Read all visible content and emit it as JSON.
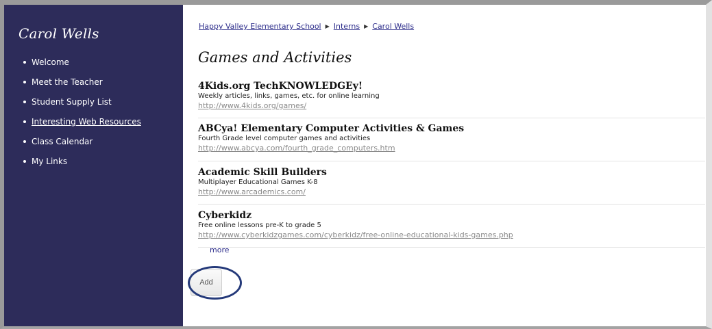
{
  "sidebar": {
    "title": "Carol Wells",
    "items": [
      {
        "label": "Welcome"
      },
      {
        "label": "Meet the Teacher"
      },
      {
        "label": "Student Supply List"
      },
      {
        "label": "Interesting Web Resources"
      },
      {
        "label": "Class Calendar"
      },
      {
        "label": "My Links"
      }
    ]
  },
  "breadcrumb": {
    "items": [
      "Happy Valley Elementary School",
      "Interns",
      "Carol Wells"
    ]
  },
  "page": {
    "title": "Games and Activities"
  },
  "links": [
    {
      "title": "4Kids.org TechKNOWLEDGEy!",
      "description": "Weekly articles, links, games, etc. for online learning",
      "url": "http://www.4kids.org/games/"
    },
    {
      "title": "ABCya! Elementary Computer Activities & Games",
      "description": "Fourth Grade level computer games and activities",
      "url": "http://www.abcya.com/fourth_grade_computers.htm"
    },
    {
      "title": "Academic Skill Builders",
      "description": "Multiplayer Educational Games K-8",
      "url": "http://www.arcademics.com/"
    },
    {
      "title": "Cyberkidz",
      "description": "Free online lessons pre-K to grade 5",
      "url": "http://www.cyberkidzgames.com/cyberkidz/free-online-educational-kids-games.php"
    }
  ],
  "actions": {
    "more_label": "more",
    "add_label": "Add"
  },
  "colors": {
    "sidebar_bg": "#2d2c5a",
    "link": "#2b2b8a",
    "highlight_circle": "#253a7a"
  }
}
